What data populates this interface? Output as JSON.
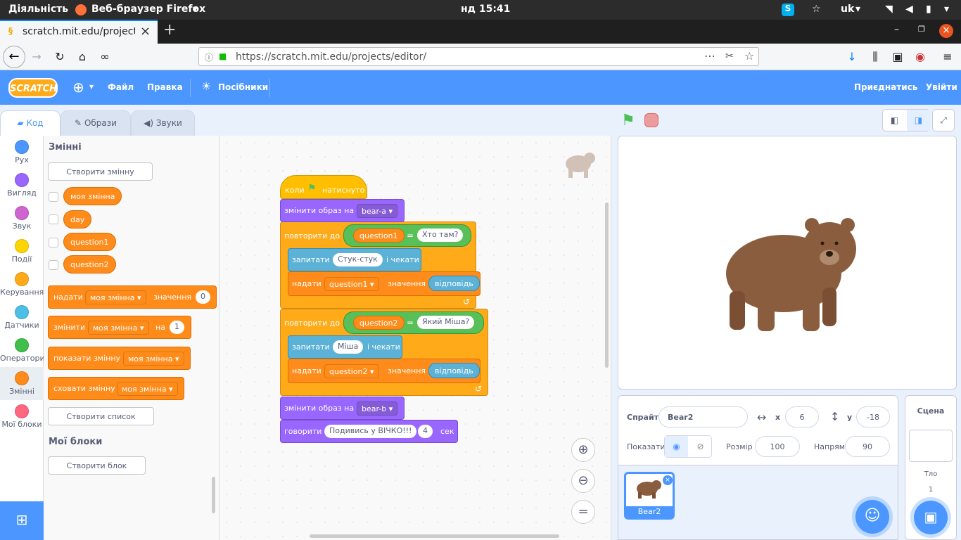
{
  "os": {
    "activities": "Діяльність",
    "app": "Веб-браузер Firefox",
    "clock": "нд 15:41",
    "lang": "uk"
  },
  "browser": {
    "tab_title": "scratch.mit.edu/projects",
    "url": "https://scratch.mit.edu/projects/editor/"
  },
  "menu": {
    "file": "Файл",
    "edit": "Правка",
    "tutorials": "Посібники",
    "join": "Приєднатись",
    "signin": "Увійти"
  },
  "tabs": {
    "code": "Код",
    "costumes": "Образи",
    "sounds": "Звуки"
  },
  "categories": [
    {
      "label": "Рух",
      "color": "#4c97ff"
    },
    {
      "label": "Вигляд",
      "color": "#9966ff"
    },
    {
      "label": "Звук",
      "color": "#cf63cf"
    },
    {
      "label": "Події",
      "color": "#ffd500"
    },
    {
      "label": "Керування",
      "color": "#ffab19"
    },
    {
      "label": "Датчики",
      "color": "#4cbfe6"
    },
    {
      "label": "Оператори",
      "color": "#40bf4a"
    },
    {
      "label": "Змінні",
      "color": "#ff8c1a"
    },
    {
      "label": "Мої блоки",
      "color": "#ff6680"
    }
  ],
  "palette": {
    "heading_vars": "Змінні",
    "make_var": "Створити змінну",
    "vars": [
      "моя змінна",
      "day",
      "question1",
      "question2"
    ],
    "set_blk": {
      "a": "надати",
      "var": "моя змінна",
      "b": "значення",
      "val": "0"
    },
    "change_blk": {
      "a": "змінити",
      "var": "моя змінна",
      "b": "на",
      "val": "1"
    },
    "show_blk": {
      "a": "показати змінну",
      "var": "моя змінна"
    },
    "hide_blk": {
      "a": "сховати змінну",
      "var": "моя змінна"
    },
    "make_list": "Створити список",
    "heading_my": "Мої блоки",
    "make_block": "Створити блок"
  },
  "script": {
    "hat_a": "коли",
    "hat_b": "натиснуто",
    "sw1": "змінити образ на",
    "sw1_val": "bear-a",
    "rep1": "повторити до",
    "rep1_var": "question1",
    "eq": "=",
    "rep1_val": "Хто там?",
    "ask1": "запитати",
    "ask1_val": "Стук-стук",
    "ask1_b": "і чекати",
    "set1": "надати",
    "set1_var": "question1",
    "set1_b": "значення",
    "answer": "відповідь",
    "rep2": "повторити до",
    "rep2_var": "question2",
    "rep2_val": "Який Міша?",
    "ask2": "запитати",
    "ask2_val": "Міша",
    "ask2_b": "і чекати",
    "set2": "надати",
    "set2_var": "question2",
    "set2_b": "значення",
    "sw2": "змінити образ на",
    "sw2_val": "bear-b",
    "say": "говорити",
    "say_val": "Подивись у ВІЧКО!!!",
    "say_secs": "4",
    "say_b": "сек"
  },
  "sprite_info": {
    "sprite_label": "Спрайт",
    "sprite_name": "Bear2",
    "x_label": "x",
    "x": "6",
    "y_label": "y",
    "y": "-18",
    "show_label": "Показати",
    "size_label": "Розмір",
    "size": "100",
    "dir_label": "Напрям",
    "direction": "90"
  },
  "sprites": [
    {
      "name": "Bear2"
    }
  ],
  "stage_panel": {
    "title": "Сцена",
    "backdrops_label": "Тло",
    "backdrops_count": "1"
  }
}
